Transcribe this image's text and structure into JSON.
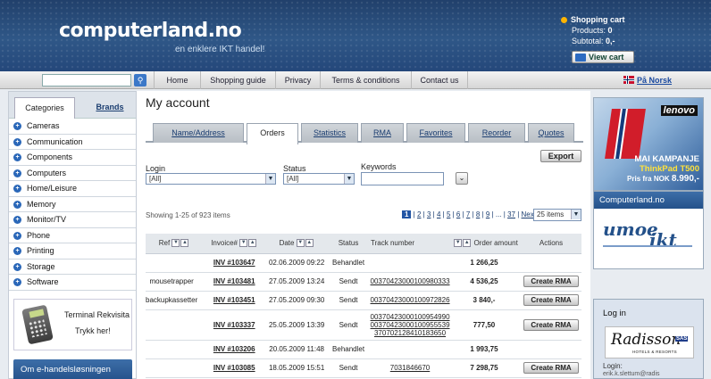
{
  "header": {
    "logo": "computerland.no",
    "tagline": "en enklere IKT handel!",
    "cart_title": "Shopping cart",
    "products_label": "Products:",
    "products_value": "0",
    "subtotal_label": "Subtotal:",
    "subtotal_value": "0,-",
    "view_cart": "View cart"
  },
  "nav": {
    "search_placeholder": "",
    "items": [
      "Home",
      "Shopping guide",
      "Privacy",
      "Terms & conditions",
      "Contact us"
    ],
    "language": "På Norsk"
  },
  "sidebar": {
    "tabs": [
      "Categories",
      "Brands"
    ],
    "categories": [
      "Cameras",
      "Communication",
      "Components",
      "Computers",
      "Home/Leisure",
      "Memory",
      "Monitor/TV",
      "Phone",
      "Printing",
      "Storage",
      "Software"
    ],
    "promo_line1": "Terminal Rekvisita",
    "promo_line2": "Trykk her!",
    "ehandel": "Om e-handelsløsningen"
  },
  "main": {
    "title": "My account",
    "tabs": [
      "Name/Address",
      "Orders",
      "Statistics",
      "RMA",
      "Favorites",
      "Reorder",
      "Quotes"
    ],
    "export": "Export",
    "filters": {
      "login_label": "Login",
      "login_value": "[All]",
      "status_label": "Status",
      "status_value": "[All]",
      "keywords_label": "Keywords",
      "keywords_value": ""
    },
    "showing": "Showing 1-25 of 923 items",
    "pager": {
      "current": "1",
      "pages": [
        "2",
        "3",
        "4",
        "5",
        "6",
        "7",
        "8",
        "9"
      ],
      "ellipsis": "...",
      "last": "37",
      "next": "Next"
    },
    "per_page": "25 items",
    "columns": [
      "Ref",
      "Invoice#",
      "Date",
      "Status",
      "Track number",
      "Order amount",
      "Actions"
    ],
    "orders": [
      {
        "ref": "",
        "invoice": "INV #103647",
        "date": "02.06.2009 09:22",
        "status": "Behandlet",
        "track": [],
        "amount": "1 266,25",
        "action": ""
      },
      {
        "ref": "mousetrapper",
        "invoice": "INV #103481",
        "date": "27.05.2009 13:24",
        "status": "Sendt",
        "track": [
          "00370423000100980333"
        ],
        "amount": "4 536,25",
        "action": "Create RMA"
      },
      {
        "ref": "backupkassetter",
        "invoice": "INV #103451",
        "date": "27.05.2009 09:30",
        "status": "Sendt",
        "track": [
          "00370423000100972826"
        ],
        "amount": "3 840,-",
        "action": "Create RMA"
      },
      {
        "ref": "",
        "invoice": "INV #103337",
        "date": "25.05.2009 13:39",
        "status": "Sendt",
        "track": [
          "00370423000100954990",
          "00370423000100955539",
          "370702128410183650"
        ],
        "amount": "777,50",
        "action": "Create RMA"
      },
      {
        "ref": "",
        "invoice": "INV #103206",
        "date": "20.05.2009 11:48",
        "status": "Behandlet",
        "track": [],
        "amount": "1 993,75",
        "action": ""
      },
      {
        "ref": "",
        "invoice": "INV #103085",
        "date": "18.05.2009 15:51",
        "status": "Sendt",
        "track": [
          "7031846670"
        ],
        "amount": "7 298,75",
        "action": "Create RMA"
      }
    ]
  },
  "right": {
    "ad_brand": "lenovo",
    "ad_line1": "MAI KAMPANJE",
    "ad_line2": "ThinkPad T500",
    "ad_price_prefix": "Pris fra NOK",
    "ad_price": "8.990,-",
    "box_title": "Computerland.no",
    "umoe": "umoe",
    "umoe_ikt": "ikt",
    "login_title": "Log in",
    "radisson": "Radisson",
    "radisson_sas": "SAS",
    "radisson_sub": "HOTELS & RESORTS",
    "login_label": "Login:",
    "login_email": "erik.k.slettum@radis"
  },
  "colors": {
    "header_bg": "#2f5787",
    "accent": "#24518a",
    "link": "#1a3d70"
  }
}
